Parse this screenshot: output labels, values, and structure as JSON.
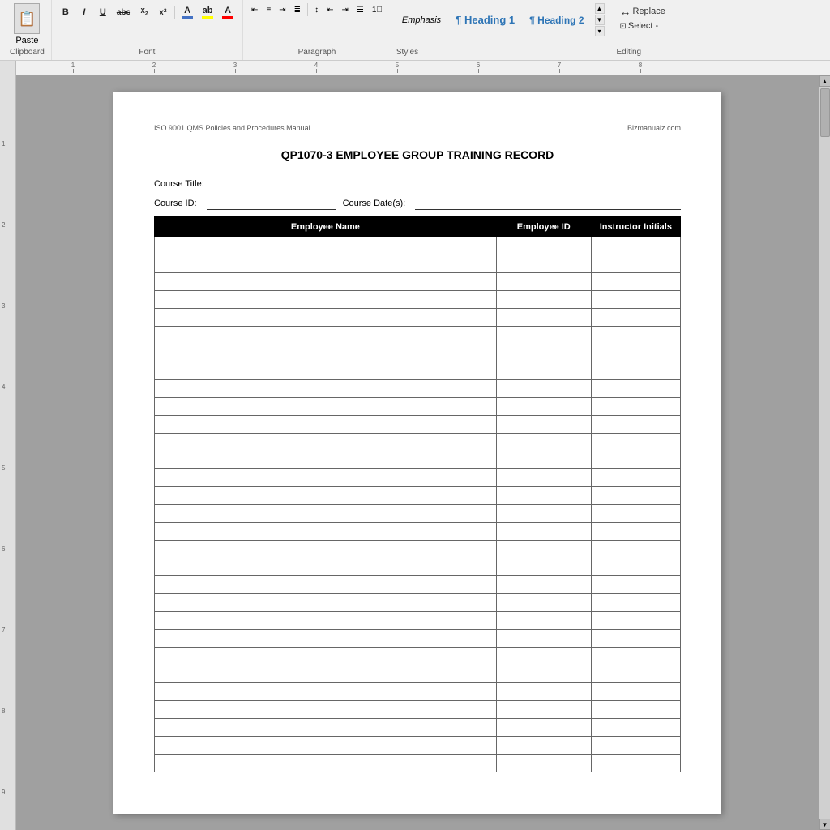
{
  "ribbon": {
    "clipboard": {
      "label": "Clipboard",
      "paste_label": "Paste"
    },
    "font": {
      "label": "Font",
      "bold": "B",
      "italic": "I",
      "underline": "U",
      "strikethrough": "abc",
      "subscript": "X₂",
      "superscript": "X²",
      "font_color": "A",
      "highlight_color": "ab",
      "text_color": "A"
    },
    "paragraph": {
      "label": "Paragraph",
      "align_left": "≡",
      "align_center": "≡",
      "align_right": "≡",
      "justify": "≡",
      "line_spacing": "↕",
      "indent_decrease": "←",
      "indent_increase": "→",
      "bullets": "•≡",
      "numbering": "1."
    },
    "styles": {
      "label": "Styles",
      "emphasis": "Emphasis",
      "heading1": "¶ Heading 1",
      "heading2": "¶ Heading 2"
    },
    "editing": {
      "label": "Editing",
      "replace": "Replace",
      "select": "Select -"
    }
  },
  "document": {
    "header_left": "ISO 9001 QMS Policies and Procedures Manual",
    "header_right": "Bizmanualz.com",
    "title": "QP1070-3 EMPLOYEE GROUP TRAINING RECORD",
    "course_title_label": "Course Title:",
    "course_id_label": "Course ID:",
    "course_dates_label": "Course Date(s):",
    "table": {
      "col_name": "Employee Name",
      "col_id": "Employee ID",
      "col_initials": "Instructor Initials",
      "rows": 30
    }
  }
}
